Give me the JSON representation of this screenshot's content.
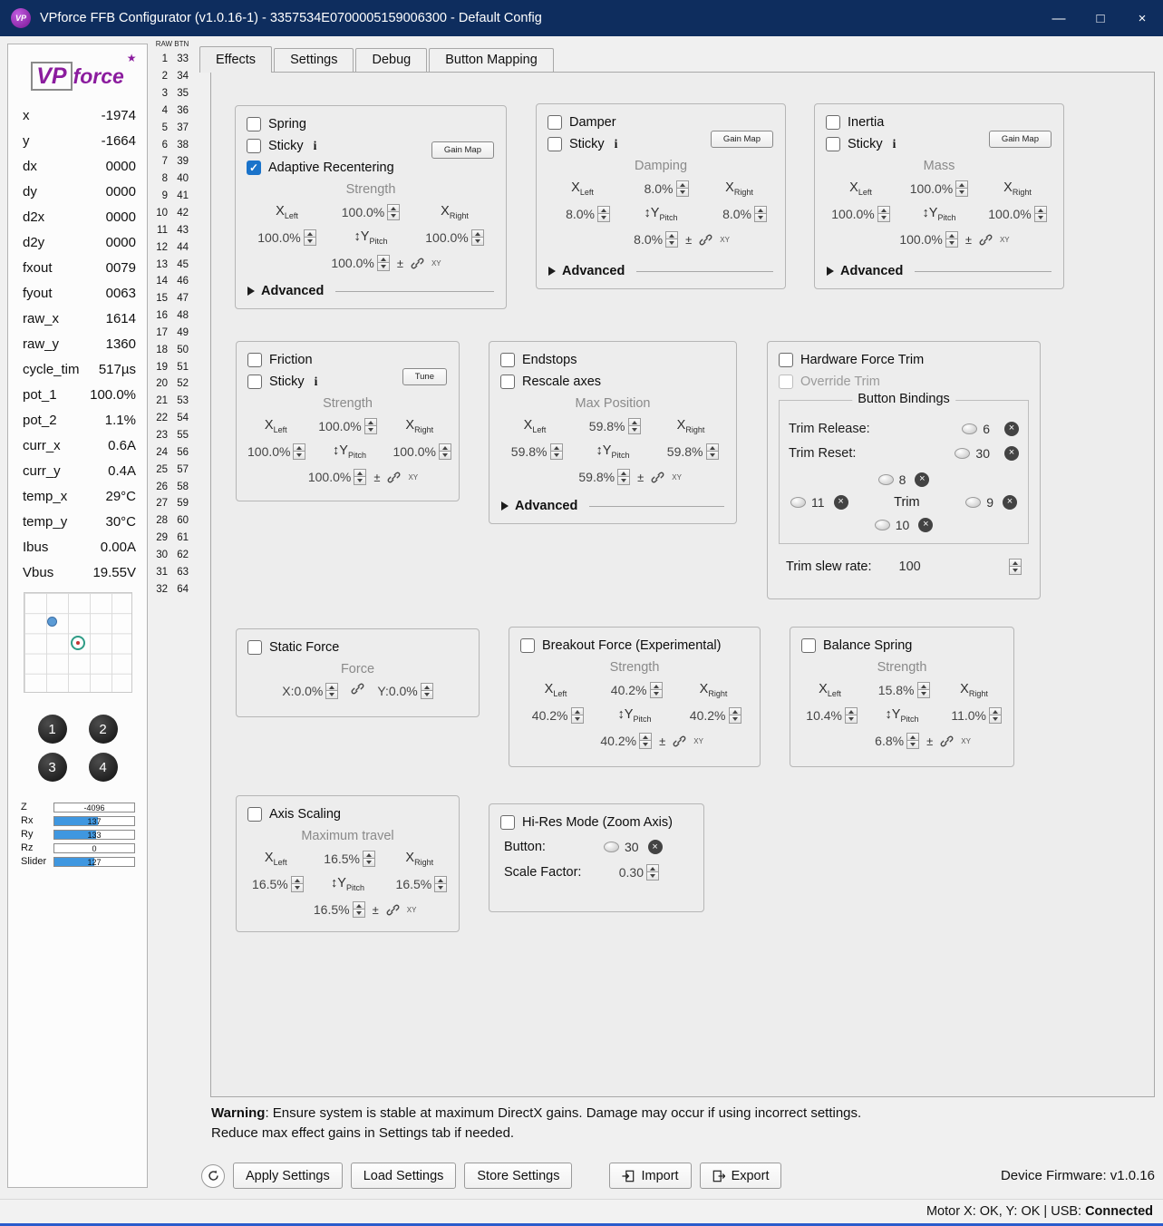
{
  "colors": {
    "titlebar": "#0e2d5e",
    "checkbox_checked": "#1a73ca",
    "bar_fill": "#3f97e0",
    "logo_purple": "#8b1c9e"
  },
  "window": {
    "title": "VPforce FFB Configurator (v1.0.16-1) - 3357534E0700005159006300 - Default Config",
    "icon_text": "VP",
    "minimize": "—",
    "maximize": "□",
    "close": "×"
  },
  "logo": {
    "vp": "VP",
    "force": "force",
    "star": "★"
  },
  "telemetry": [
    {
      "label": "x",
      "value": "-1974"
    },
    {
      "label": "y",
      "value": "-1664"
    },
    {
      "label": "dx",
      "value": "0000"
    },
    {
      "label": "dy",
      "value": "0000"
    },
    {
      "label": "d2x",
      "value": "0000"
    },
    {
      "label": "d2y",
      "value": "0000"
    },
    {
      "label": "fxout",
      "value": "0079"
    },
    {
      "label": "fyout",
      "value": "0063"
    },
    {
      "label": "raw_x",
      "value": "1614"
    },
    {
      "label": "raw_y",
      "value": "1360"
    },
    {
      "label": "cycle_tim",
      "value": "517µs"
    },
    {
      "label": "pot_1",
      "value": "100.0%"
    },
    {
      "label": "pot_2",
      "value": "1.1%"
    },
    {
      "label": "curr_x",
      "value": "0.6A"
    },
    {
      "label": "curr_y",
      "value": "0.4A"
    },
    {
      "label": "temp_x",
      "value": "29°C"
    },
    {
      "label": "temp_y",
      "value": "30°C"
    },
    {
      "label": "Ibus",
      "value": "0.00A"
    },
    {
      "label": "Vbus",
      "value": "19.55V"
    }
  ],
  "presets": [
    "1",
    "2",
    "3",
    "4"
  ],
  "axis_bars": [
    {
      "label": "Z",
      "value": "-4096",
      "fill": 0
    },
    {
      "label": "Rx",
      "value": "137",
      "fill": 54
    },
    {
      "label": "Ry",
      "value": "133",
      "fill": 52
    },
    {
      "label": "Rz",
      "value": "0",
      "fill": 0
    },
    {
      "label": "Slider",
      "value": "127",
      "fill": 50
    }
  ],
  "raw_btn": {
    "header": "RAW BTN",
    "col1": [
      1,
      2,
      3,
      4,
      5,
      6,
      7,
      8,
      9,
      10,
      11,
      12,
      13,
      14,
      15,
      16,
      17,
      18,
      19,
      20,
      21,
      22,
      23,
      24,
      25,
      26,
      27,
      28,
      29,
      30,
      31,
      32
    ],
    "col2": [
      33,
      34,
      35,
      36,
      37,
      38,
      39,
      40,
      41,
      42,
      43,
      44,
      45,
      46,
      47,
      48,
      49,
      50,
      51,
      52,
      53,
      54,
      55,
      56,
      57,
      58,
      59,
      60,
      61,
      62,
      63,
      64
    ]
  },
  "tabs": [
    "Effects",
    "Settings",
    "Debug",
    "Button Mapping"
  ],
  "common": {
    "sticky": "Sticky",
    "info": "i",
    "gain_map": "Gain Map",
    "advanced": "Advanced",
    "x": "X",
    "left": "Left",
    "right": "Right",
    "updown": "↕",
    "y": "Y",
    "pitch": "Pitch",
    "plus_minus": "±",
    "xy": "XY",
    "clear": "×"
  },
  "panels": {
    "spring": {
      "title": "Spring",
      "adaptive": "Adaptive Recentering",
      "section": "Strength",
      "values": [
        "100.0%",
        "100.0%",
        "100.0%",
        "100.0%"
      ]
    },
    "damper": {
      "title": "Damper",
      "section": "Damping",
      "values": [
        "8.0%",
        "8.0%",
        "8.0%",
        "8.0%"
      ]
    },
    "inertia": {
      "title": "Inertia",
      "section": "Mass",
      "values": [
        "100.0%",
        "100.0%",
        "100.0%",
        "100.0%"
      ]
    },
    "friction": {
      "title": "Friction",
      "tune": "Tune",
      "section": "Strength",
      "values": [
        "100.0%",
        "100.0%",
        "100.0%",
        "100.0%"
      ]
    },
    "endstops": {
      "title": "Endstops",
      "rescale": "Rescale axes",
      "section": "Max Position",
      "values": [
        "59.8%",
        "59.8%",
        "59.8%",
        "59.8%"
      ]
    },
    "trim": {
      "title": "Hardware Force Trim",
      "override": "Override Trim",
      "bindings_title": "Button Bindings",
      "release_label": "Trim Release:",
      "release_btn": "6",
      "reset_label": "Trim Reset:",
      "reset_btn": "30",
      "up_btn": "8",
      "left_btn": "11",
      "center": "Trim",
      "right_btn": "9",
      "down_btn": "10",
      "slew_label": "Trim slew rate:",
      "slew_value": "100"
    },
    "static": {
      "title": "Static Force",
      "section": "Force",
      "x_value": "X:0.0%",
      "y_value": "Y:0.0%"
    },
    "breakout": {
      "title": "Breakout Force (Experimental)",
      "section": "Strength",
      "values": [
        "40.2%",
        "40.2%",
        "40.2%",
        "40.2%"
      ]
    },
    "balance": {
      "title": "Balance Spring",
      "section": "Strength",
      "values": [
        "15.8%",
        "10.4%",
        "11.0%",
        "6.8%"
      ]
    },
    "axis_scaling": {
      "title": "Axis Scaling",
      "section": "Maximum travel",
      "values": [
        "16.5%",
        "16.5%",
        "16.5%",
        "16.5%"
      ]
    },
    "hires": {
      "title": "Hi-Res Mode (Zoom Axis)",
      "button_label": "Button:",
      "button_value": "30",
      "scale_label": "Scale Factor:",
      "scale_value": "0.30"
    }
  },
  "warning": {
    "bold": "Warning",
    "line1": ": Ensure system is stable at maximum DirectX gains. Damage may occur if using incorrect settings.",
    "line2": "Reduce max effect gains in Settings tab if needed."
  },
  "footer": {
    "apply": "Apply Settings",
    "load": "Load Settings",
    "store": "Store Settings",
    "import": "Import",
    "export": "Export",
    "firmware": "Device Firmware: v1.0.16"
  },
  "statusbar": {
    "prefix": "Motor X: OK, Y: OK | USB: ",
    "connected": "Connected"
  }
}
